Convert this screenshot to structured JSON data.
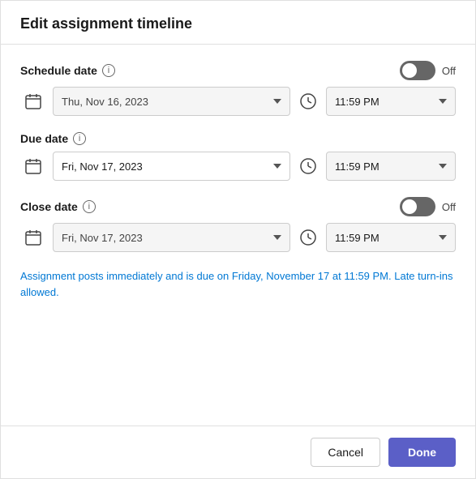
{
  "dialog": {
    "title": "Edit assignment timeline"
  },
  "schedule_date": {
    "label": "Schedule date",
    "info_icon": "i",
    "toggle_off_label": "Off",
    "date_value": "Thu, Nov 16, 2023",
    "date_placeholder": "Thu, Nov 16, 2023",
    "time_value": "11:59 PM",
    "enabled": false
  },
  "due_date": {
    "label": "Due date",
    "info_icon": "i",
    "date_value": "Fri, Nov 17, 2023",
    "time_value": "11:59 PM",
    "enabled": true
  },
  "close_date": {
    "label": "Close date",
    "info_icon": "i",
    "toggle_off_label": "Off",
    "date_value": "Fri, Nov 17, 2023",
    "date_placeholder": "Fri, Nov 17, 2023",
    "time_value": "11:59 PM",
    "enabled": false
  },
  "info_text": "Assignment posts immediately and is due on Friday, November 17 at 11:59 PM. Late turn-ins allowed.",
  "footer": {
    "cancel_label": "Cancel",
    "done_label": "Done"
  }
}
